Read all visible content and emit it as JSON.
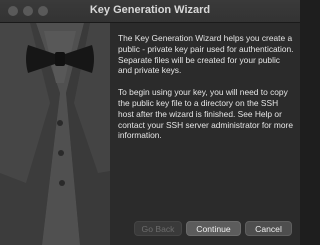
{
  "window": {
    "title": "Key Generation Wizard"
  },
  "content": {
    "paragraph1": "The Key Generation Wizard helps you create a public - private key pair used for authentication. Separate files will be created for your public and private keys.",
    "paragraph2": "To begin using your key, you will need to copy the public key file to a directory on the SSH host after the wizard is finished. See Help or contact your SSH server administrator for more information."
  },
  "buttons": {
    "back": "Go Back",
    "continue": "Continue",
    "cancel": "Cancel"
  },
  "illustration": "tuxedo-bowtie-icon"
}
